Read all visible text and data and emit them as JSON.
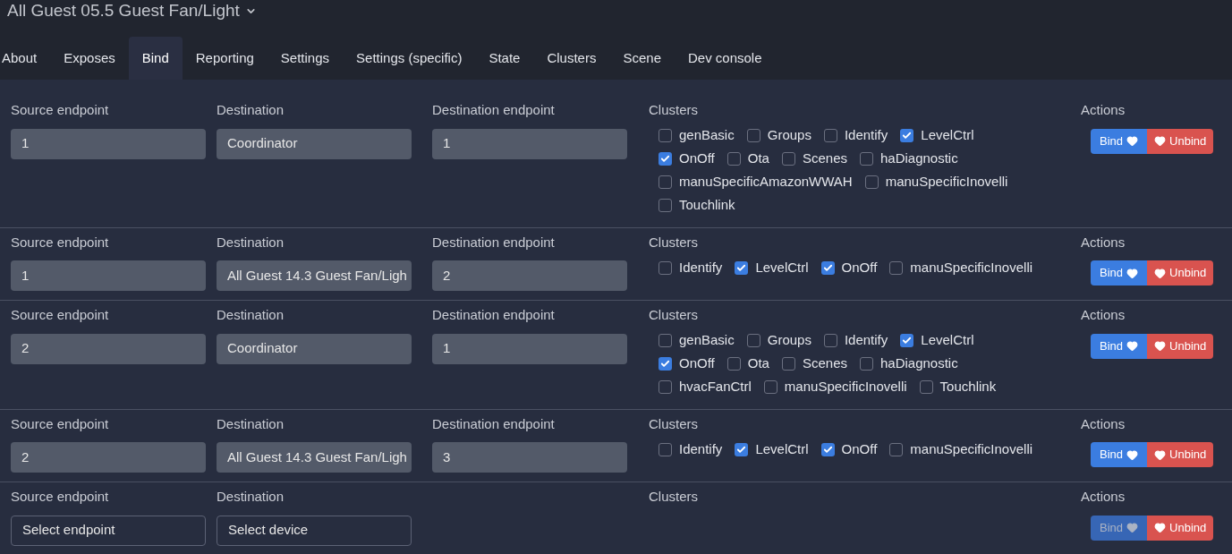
{
  "title": "All Guest 05.5 Guest Fan/Light",
  "tabs": [
    {
      "label": "About",
      "selected": false
    },
    {
      "label": "Exposes",
      "selected": false
    },
    {
      "label": "Bind",
      "selected": true
    },
    {
      "label": "Reporting",
      "selected": false
    },
    {
      "label": "Settings",
      "selected": false
    },
    {
      "label": "Settings (specific)",
      "selected": false
    },
    {
      "label": "State",
      "selected": false
    },
    {
      "label": "Clusters",
      "selected": false
    },
    {
      "label": "Scene",
      "selected": false
    },
    {
      "label": "Dev console",
      "selected": false
    }
  ],
  "bindings": [
    {
      "source_label": "Source endpoint",
      "source": {
        "kind": "value",
        "text": "1"
      },
      "destination_label": "Destination",
      "destination": {
        "kind": "value",
        "text": "Coordinator"
      },
      "dest_endpoint_label": "Destination endpoint",
      "dest_endpoint": {
        "kind": "value",
        "text": "1"
      },
      "clusters_label": "Clusters",
      "clusters": [
        {
          "name": "genBasic",
          "checked": false
        },
        {
          "name": "Groups",
          "checked": false
        },
        {
          "name": "Identify",
          "checked": false
        },
        {
          "name": "LevelCtrl",
          "checked": true
        },
        {
          "name": "OnOff",
          "checked": true
        },
        {
          "name": "Ota",
          "checked": false
        },
        {
          "name": "Scenes",
          "checked": false
        },
        {
          "name": "haDiagnostic",
          "checked": false
        },
        {
          "name": "manuSpecificAmazonWWAH",
          "checked": false
        },
        {
          "name": "manuSpecificInovelli",
          "checked": false
        },
        {
          "name": "Touchlink",
          "checked": false
        }
      ],
      "actions_label": "Actions",
      "bind": {
        "label": "Bind",
        "disabled": false
      },
      "unbind": {
        "label": "Unbind",
        "disabled": false
      }
    },
    {
      "source_label": "Source endpoint",
      "source": {
        "kind": "value",
        "text": "1"
      },
      "destination_label": "Destination",
      "destination": {
        "kind": "value",
        "text": "All Guest 14.3 Guest Fan/Ligh"
      },
      "dest_endpoint_label": "Destination endpoint",
      "dest_endpoint": {
        "kind": "value",
        "text": "2"
      },
      "clusters_label": "Clusters",
      "clusters": [
        {
          "name": "Identify",
          "checked": false
        },
        {
          "name": "LevelCtrl",
          "checked": true
        },
        {
          "name": "OnOff",
          "checked": true
        },
        {
          "name": "manuSpecificInovelli",
          "checked": false
        }
      ],
      "actions_label": "Actions",
      "bind": {
        "label": "Bind",
        "disabled": false
      },
      "unbind": {
        "label": "Unbind",
        "disabled": false
      }
    },
    {
      "source_label": "Source endpoint",
      "source": {
        "kind": "value",
        "text": "2"
      },
      "destination_label": "Destination",
      "destination": {
        "kind": "value",
        "text": "Coordinator"
      },
      "dest_endpoint_label": "Destination endpoint",
      "dest_endpoint": {
        "kind": "value",
        "text": "1"
      },
      "clusters_label": "Clusters",
      "clusters": [
        {
          "name": "genBasic",
          "checked": false
        },
        {
          "name": "Groups",
          "checked": false
        },
        {
          "name": "Identify",
          "checked": false
        },
        {
          "name": "LevelCtrl",
          "checked": true
        },
        {
          "name": "OnOff",
          "checked": true
        },
        {
          "name": "Ota",
          "checked": false
        },
        {
          "name": "Scenes",
          "checked": false
        },
        {
          "name": "haDiagnostic",
          "checked": false
        },
        {
          "name": "hvacFanCtrl",
          "checked": false
        },
        {
          "name": "manuSpecificInovelli",
          "checked": false
        },
        {
          "name": "Touchlink",
          "checked": false
        }
      ],
      "actions_label": "Actions",
      "bind": {
        "label": "Bind",
        "disabled": false
      },
      "unbind": {
        "label": "Unbind",
        "disabled": false
      }
    },
    {
      "source_label": "Source endpoint",
      "source": {
        "kind": "value",
        "text": "2"
      },
      "destination_label": "Destination",
      "destination": {
        "kind": "value",
        "text": "All Guest 14.3 Guest Fan/Ligh"
      },
      "dest_endpoint_label": "Destination endpoint",
      "dest_endpoint": {
        "kind": "value",
        "text": "3"
      },
      "clusters_label": "Clusters",
      "clusters": [
        {
          "name": "Identify",
          "checked": false
        },
        {
          "name": "LevelCtrl",
          "checked": true
        },
        {
          "name": "OnOff",
          "checked": true
        },
        {
          "name": "manuSpecificInovelli",
          "checked": false
        }
      ],
      "actions_label": "Actions",
      "bind": {
        "label": "Bind",
        "disabled": false
      },
      "unbind": {
        "label": "Unbind",
        "disabled": false
      }
    },
    {
      "source_label": "Source endpoint",
      "source": {
        "kind": "select",
        "text": "Select endpoint"
      },
      "destination_label": "Destination",
      "destination": {
        "kind": "select",
        "text": "Select device"
      },
      "clusters_label": "Clusters",
      "actions_label": "Actions",
      "bind": {
        "label": "Bind",
        "disabled": true
      },
      "unbind": {
        "label": "Unbind",
        "disabled": false
      }
    }
  ]
}
